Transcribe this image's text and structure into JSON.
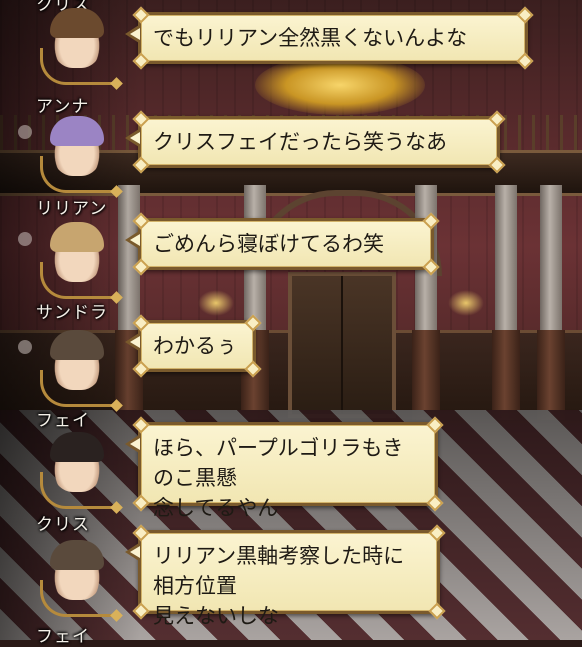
{
  "chat": {
    "top_partial_name": "クリス",
    "messages": [
      {
        "name": "アンナ",
        "text": "でもリリアン全然黒くないんよな",
        "hair": "#6b4a2e"
      },
      {
        "name": "リリアン",
        "text": "クリスフェイだったら笑うなあ",
        "hair": "#9b84c4"
      },
      {
        "name": "サンドラ",
        "text": "ごめんら寝ぼけてるわ笑",
        "hair": "#c7a56f"
      },
      {
        "name": "フェイ",
        "text": "わかるぅ",
        "hair": "#5a4a3c"
      },
      {
        "name": "クリス",
        "text": "ほら、パープルゴリラもきのこ黒懸\n念してるやん",
        "hair": "#2a2220"
      },
      {
        "name": "フェイ",
        "text": "リリアン黒軸考察した時に相方位置\n見えないしな",
        "hair": "#5a4a3c"
      }
    ]
  },
  "icons": {
    "avatar": "character-portrait-icon",
    "frame": "ornate-frame-icon"
  }
}
